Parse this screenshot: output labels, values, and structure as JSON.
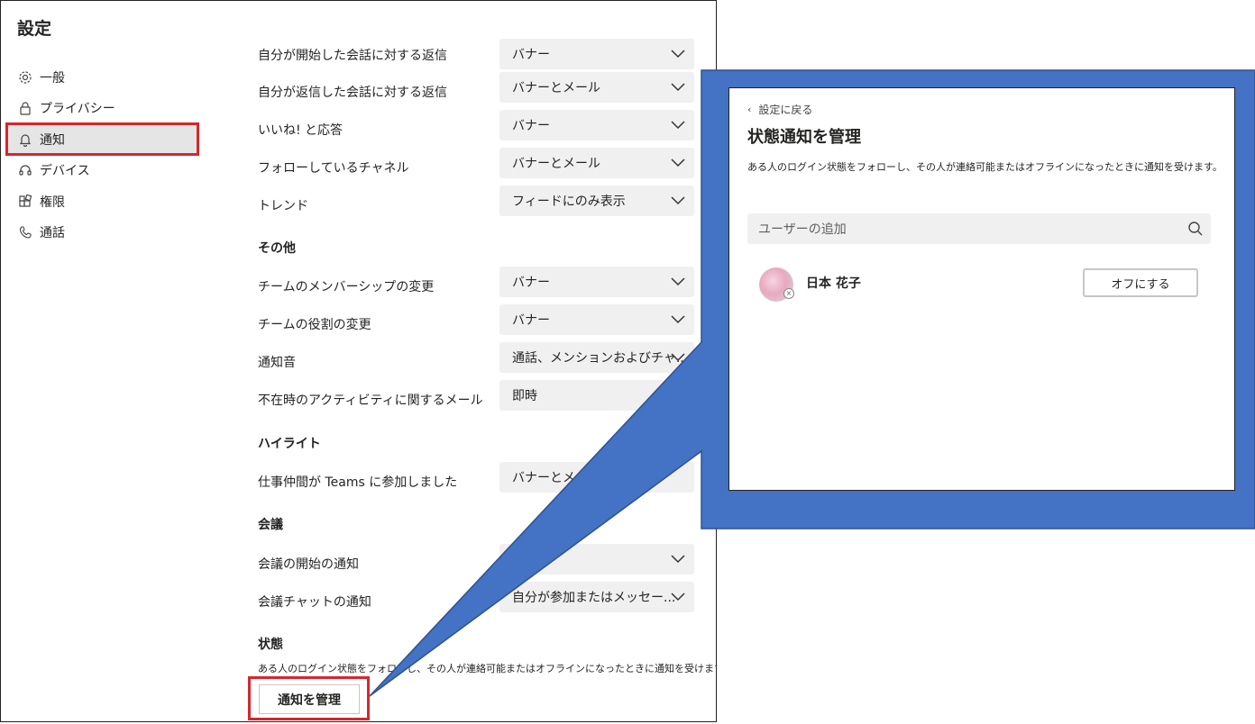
{
  "settings": {
    "title": "設定",
    "nav": [
      {
        "label": "一般",
        "icon": "gear-icon"
      },
      {
        "label": "プライバシー",
        "icon": "lock-icon"
      },
      {
        "label": "通知",
        "icon": "bell-icon"
      },
      {
        "label": "デバイス",
        "icon": "headset-icon"
      },
      {
        "label": "権限",
        "icon": "apps-icon"
      },
      {
        "label": "通話",
        "icon": "phone-icon"
      }
    ],
    "active_nav": "通知",
    "rows": [
      {
        "label": "自分が開始した会話に対する返信",
        "value": "バナー"
      },
      {
        "label": "自分が返信した会話に対する返信",
        "value": "バナーとメール"
      },
      {
        "label": "いいね! と応答",
        "value": "バナー"
      },
      {
        "label": "フォローしているチャネル",
        "value": "バナーとメール"
      },
      {
        "label": "トレンド",
        "value": "フィードにのみ表示"
      },
      {
        "label": "チームのメンバーシップの変更",
        "value": "バナー"
      },
      {
        "label": "チームの役割の変更",
        "value": "バナー"
      },
      {
        "label": "通知音",
        "value": "通話、メンションおよびチャ..."
      },
      {
        "label": "不在時のアクティビティに関するメール",
        "value": "即時"
      },
      {
        "label": "仕事仲間が Teams に参加しました",
        "value": "バナーとメール"
      },
      {
        "label": "会議の開始の通知",
        "value": ""
      },
      {
        "label": "会議チャットの通知",
        "value": "自分が参加またはメッセー..."
      }
    ],
    "sections": {
      "other": "その他",
      "highlights": "ハイライト",
      "meetings": "会議",
      "status": "状態"
    },
    "status_desc": "ある人のログイン状態をフォローし、その人が連絡可能またはオフラインになったときに通知を受けます。",
    "manage_button": "通知を管理"
  },
  "panel": {
    "back_label": "設定に戻る",
    "title": "状態通知を管理",
    "desc": "ある人のログイン状態をフォローし、その人が連絡可能またはオフラインになったときに通知を受けます。",
    "search_placeholder": "ユーザーの追加",
    "user": {
      "name": "日本 花子",
      "button": "オフにする"
    }
  },
  "colors": {
    "highlight": "#d7262d",
    "callout": "#4472c4",
    "dropdown_bg": "#f0f0f0"
  }
}
